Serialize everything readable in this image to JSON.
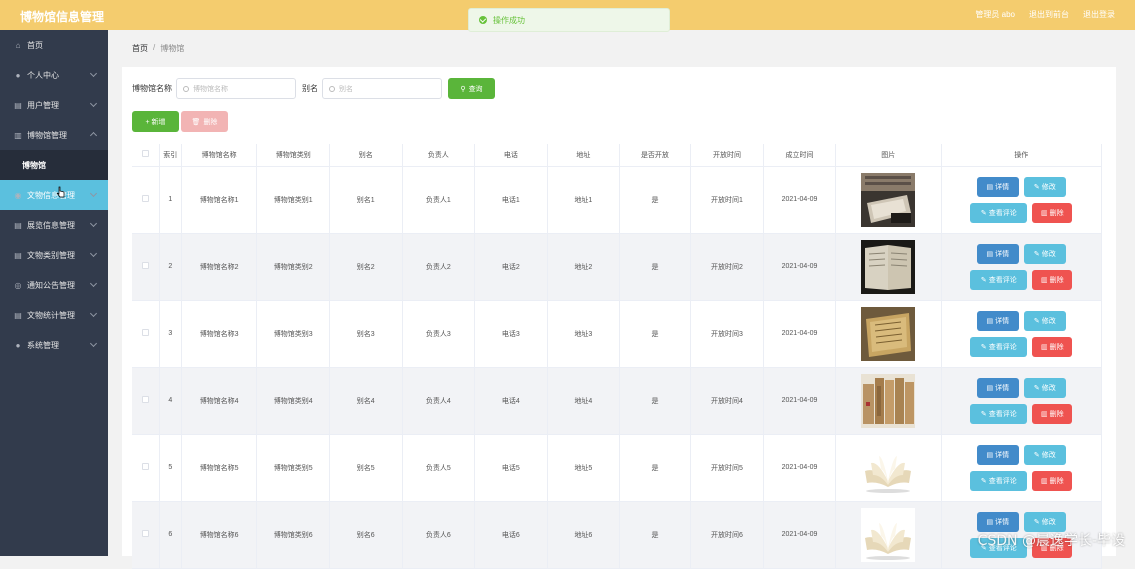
{
  "app": {
    "title": "博物馆信息管理"
  },
  "header_links": [
    "管理员 abo",
    "退出到前台",
    "退出登录"
  ],
  "toast": {
    "text": "操作成功"
  },
  "sidebar": {
    "items": [
      {
        "label": "首页",
        "icon": "home-icon",
        "chevron": false
      },
      {
        "label": "个人中心",
        "icon": "user-icon",
        "chevron": true
      },
      {
        "label": "用户管理",
        "icon": "grid-icon",
        "chevron": true
      },
      {
        "label": "博物馆管理",
        "icon": "archive-icon",
        "chevron": true,
        "open": true
      },
      {
        "label": "文物信息管理",
        "icon": "pin-icon",
        "chevron": true,
        "active": true
      },
      {
        "label": "展览信息管理",
        "icon": "grid-icon",
        "chevron": true
      },
      {
        "label": "文物类别管理",
        "icon": "grid-icon",
        "chevron": true
      },
      {
        "label": "通知公告管理",
        "icon": "bell-icon",
        "chevron": true
      },
      {
        "label": "文物统计管理",
        "icon": "grid-icon",
        "chevron": true
      },
      {
        "label": "系统管理",
        "icon": "user-icon",
        "chevron": true
      }
    ],
    "sub_item": "博物馆"
  },
  "breadcrumb": {
    "home": "首页",
    "sep": "/",
    "current": "博物馆"
  },
  "search": {
    "name_label": "博物馆名称",
    "name_placeholder": "博物馆名称",
    "alias_label": "别名",
    "alias_placeholder": "别名",
    "query_button": "查询"
  },
  "actions": {
    "add": "+ 新增",
    "delete": "删除"
  },
  "table": {
    "headers": [
      "",
      "索引",
      "博物馆名称",
      "博物馆类别",
      "别名",
      "负责人",
      "电话",
      "地址",
      "是否开放",
      "开放时间",
      "成立时间",
      "图片",
      "操作"
    ],
    "rows": [
      {
        "index": "1",
        "name": "博物馆名称1",
        "category": "博物馆类别1",
        "alias": "别名1",
        "owner": "负责人1",
        "phone": "电话1",
        "address": "地址1",
        "open": "是",
        "open_time": "开放时间1",
        "founded": "2021-04-09",
        "image": "photo-library-shelves"
      },
      {
        "index": "2",
        "name": "博物馆名称2",
        "category": "博物馆类别2",
        "alias": "别名2",
        "owner": "负责人2",
        "phone": "电话2",
        "address": "地址2",
        "open": "是",
        "open_time": "开放时间2",
        "founded": "2021-04-09",
        "image": "photo-old-book"
      },
      {
        "index": "3",
        "name": "博物馆名称3",
        "category": "博物馆类别3",
        "alias": "别名3",
        "owner": "负责人3",
        "phone": "电话3",
        "address": "地址3",
        "open": "是",
        "open_time": "开放时间3",
        "founded": "2021-04-09",
        "image": "photo-ancient-scroll"
      },
      {
        "index": "4",
        "name": "博物馆名称4",
        "category": "博物馆类别4",
        "alias": "别名4",
        "owner": "负责人4",
        "phone": "电话4",
        "address": "地址4",
        "open": "是",
        "open_time": "开放时间4",
        "founded": "2021-04-09",
        "image": "photo-bamboo-slips"
      },
      {
        "index": "5",
        "name": "博物馆名称5",
        "category": "博物馆类别5",
        "alias": "别名5",
        "owner": "负责人5",
        "phone": "电话5",
        "address": "地址5",
        "open": "是",
        "open_time": "开放时间5",
        "founded": "2021-04-09",
        "image": "photo-open-book"
      },
      {
        "index": "6",
        "name": "博物馆名称6",
        "category": "博物馆类别6",
        "alias": "别名6",
        "owner": "负责人6",
        "phone": "电话6",
        "address": "地址6",
        "open": "是",
        "open_time": "开放时间6",
        "founded": "2021-04-09",
        "image": "photo-open-book"
      }
    ],
    "ops": {
      "detail": "详情",
      "edit": "修改",
      "comment": "查看评论",
      "delete": "删除"
    }
  },
  "watermark": "CSDN @晨逸学长-毕设",
  "colors": {
    "header": "#f4cc6e",
    "sidebar": "#323b4c",
    "active": "#5bc0de",
    "green": "#5ab53a",
    "blue": "#428bca",
    "red": "#ef5350"
  }
}
